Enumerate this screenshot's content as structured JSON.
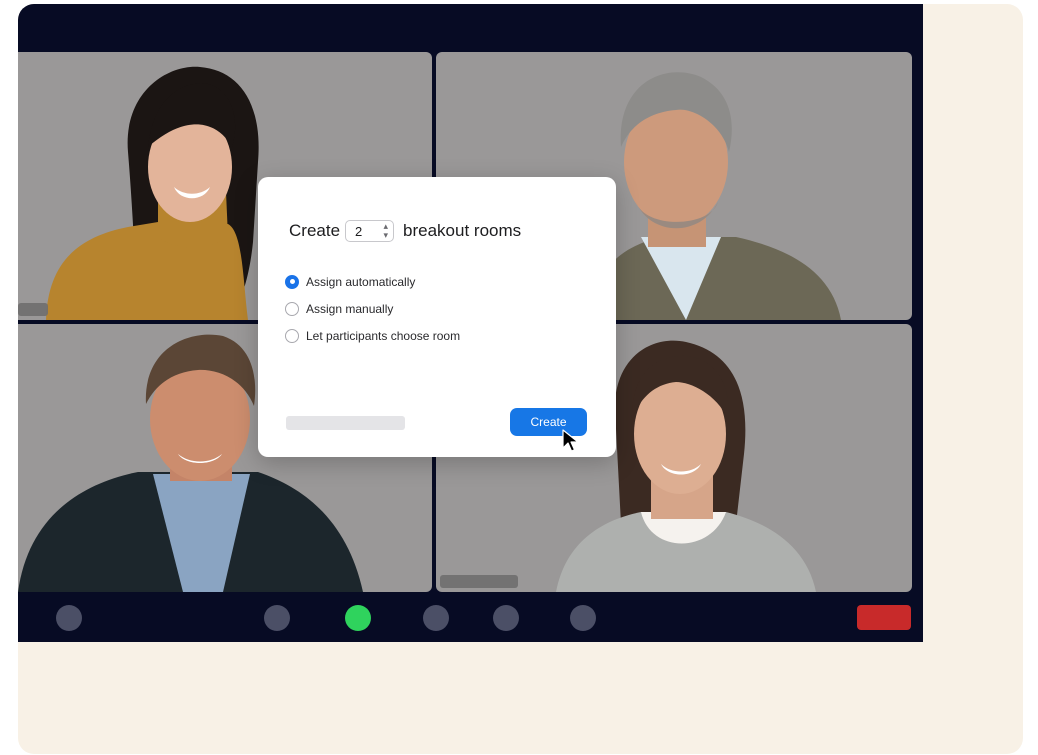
{
  "dialog": {
    "title_prefix": "Create",
    "room_count": "2",
    "title_suffix": "breakout rooms",
    "options": [
      {
        "label": "Assign automatically",
        "selected": true
      },
      {
        "label": "Assign manually",
        "selected": false
      },
      {
        "label": "Let participants choose room",
        "selected": false
      }
    ],
    "create_label": "Create"
  },
  "toolbar": {
    "buttons": [
      "control",
      "control",
      "active-control",
      "control",
      "control",
      "control",
      "end"
    ]
  },
  "colors": {
    "background": "#f8f1e6",
    "window": "#070b24",
    "tile": "#9a9898",
    "accent": "#1777e6",
    "active": "#2fd35d",
    "end": "#c82a2a"
  }
}
